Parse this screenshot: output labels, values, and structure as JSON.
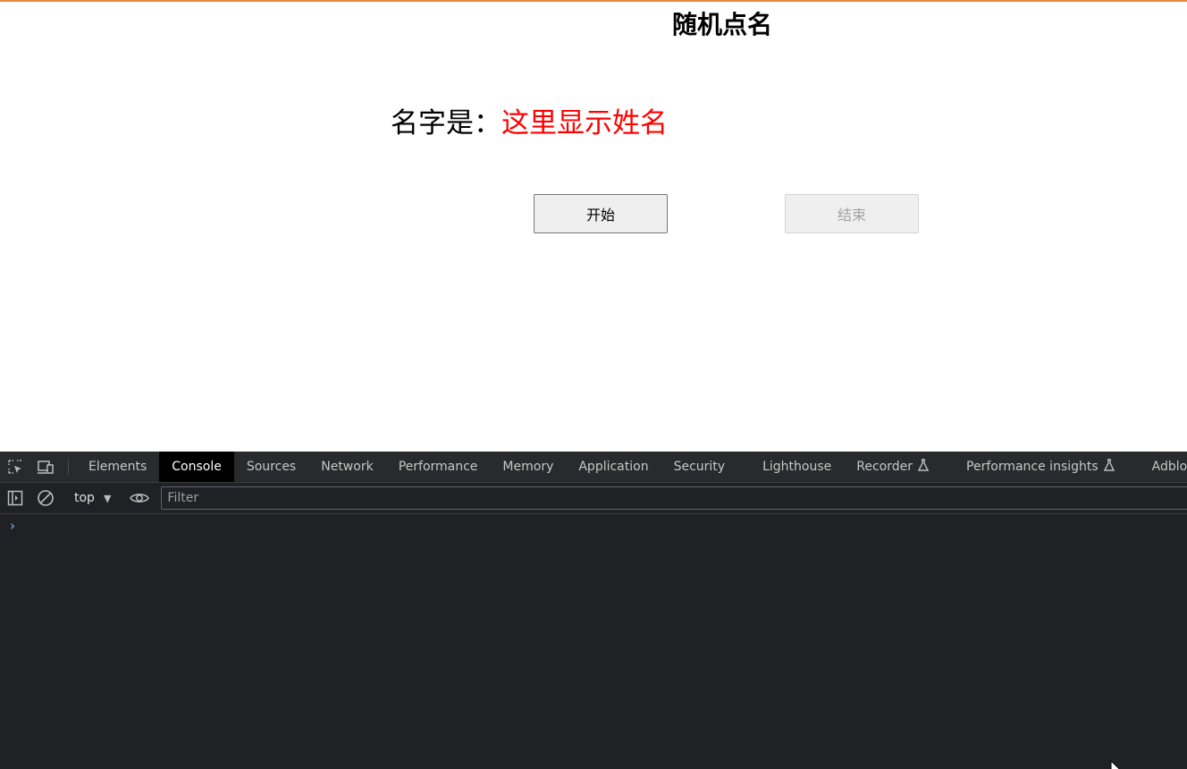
{
  "page": {
    "title": "随机点名",
    "name_label": "名字是：",
    "name_value": "这里显示姓名",
    "start_button": "开始",
    "end_button": "结束"
  },
  "devtools": {
    "tabs": [
      "Elements",
      "Console",
      "Sources",
      "Network",
      "Performance",
      "Memory",
      "Application",
      "Security",
      "Lighthouse",
      "Recorder",
      "Performance insights",
      "Adblock Plu"
    ],
    "active_tab": "Console",
    "context": "top",
    "filter_placeholder": "Filter",
    "prompt": "›"
  },
  "colors": {
    "accent_top_border": "#e8893a",
    "name_value": "#ff0000",
    "devtools_bg": "#202124"
  }
}
